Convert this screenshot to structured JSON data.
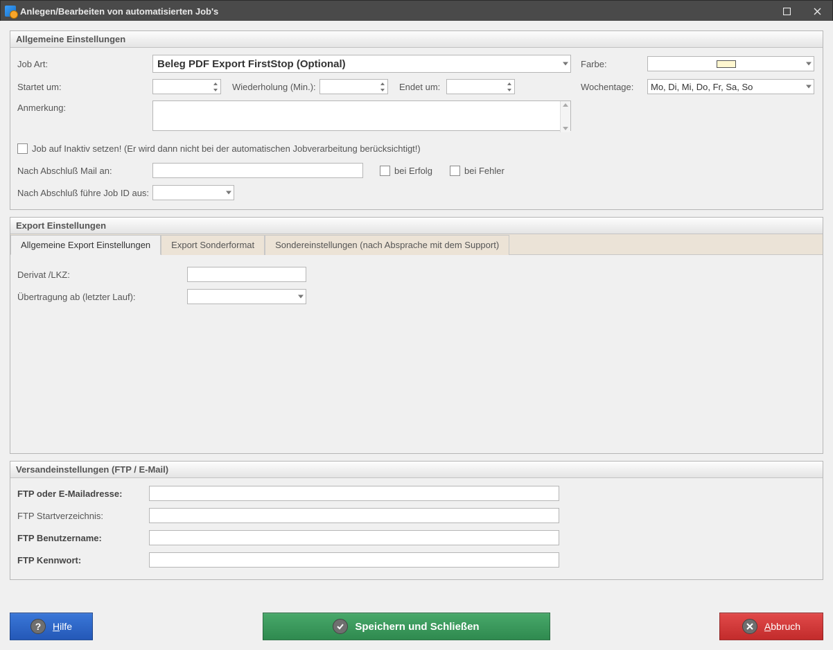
{
  "window": {
    "title": "Anlegen/Bearbeiten von automatisierten Job's"
  },
  "sections": {
    "general": {
      "header": "Allgemeine Einstellungen",
      "job_art_label": "Job Art:",
      "job_art_value": "Beleg PDF Export FirstStop (Optional)",
      "farbe_label": "Farbe:",
      "startet_um_label": "Startet um:",
      "wiederholung_label": "Wiederholung (Min.):",
      "endet_um_label": "Endet um:",
      "wochentage_label": "Wochentage:",
      "wochentage_value": "Mo, Di, Mi, Do, Fr, Sa, So",
      "anmerkung_label": "Anmerkung:",
      "inaktiv_label": "Job auf Inaktiv setzen! (Er wird dann nicht bei der automatischen Jobverarbeitung berücksichtigt!)",
      "mail_label": "Nach Abschluß Mail an:",
      "bei_erfolg_label": "bei Erfolg",
      "bei_fehler_label": "bei Fehler",
      "jobid_label": "Nach Abschluß führe Job ID aus:"
    },
    "export": {
      "header": "Export Einstellungen",
      "tabs": [
        "Allgemeine Export Einstellungen",
        "Export Sonderformat",
        "Sondereinstellungen (nach Absprache mit dem Support)"
      ],
      "derivat_label": "Derivat /LKZ:",
      "uebertragung_label": "Übertragung ab (letzter Lauf):"
    },
    "versand": {
      "header": "Versandeinstellungen (FTP / E-Mail)",
      "ftp_mail_label": "FTP oder E-Mailadresse:",
      "ftp_startdir_label": "FTP Startverzeichnis:",
      "ftp_user_label": "FTP Benutzername:",
      "ftp_pass_label": "FTP Kennwort:"
    }
  },
  "buttons": {
    "help": "Hilfe",
    "save": "Speichern und Schließen",
    "cancel": "Abbruch"
  }
}
